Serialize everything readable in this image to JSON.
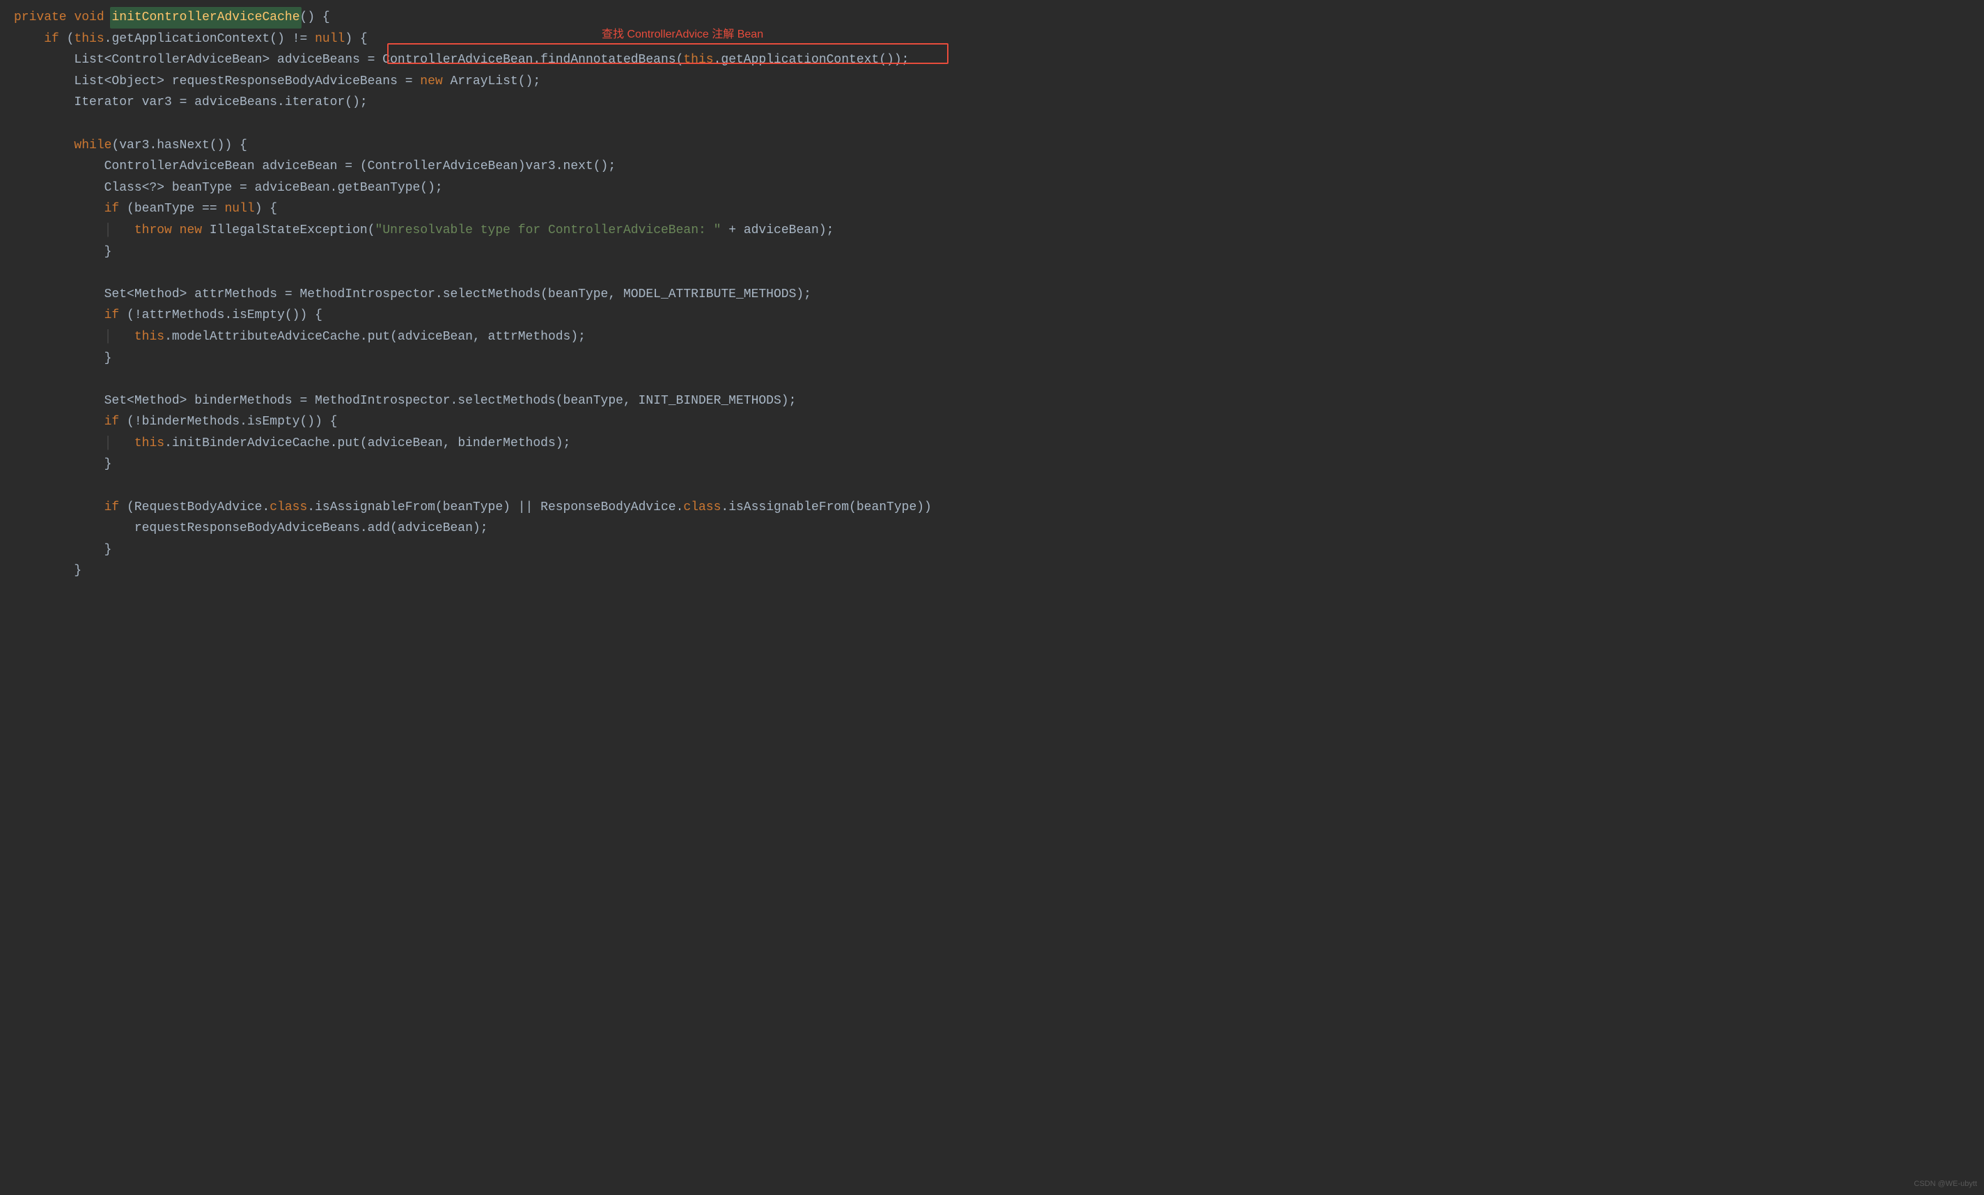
{
  "annotation": "查找 ControllerAdvice 注解 Bean",
  "watermark": "CSDN @WE-ubytt",
  "code": {
    "kw_private": "private",
    "kw_void": "void",
    "kw_if": "if",
    "kw_null": "null",
    "kw_new": "new",
    "kw_while": "while",
    "kw_throw": "throw",
    "kw_this": "this",
    "kw_class": "class",
    "method_def": "initControllerAdviceCache",
    "l1_tail": "() {",
    "l2_a": "    ",
    "l2_b": " (",
    "l2_c": ".getApplicationContext() != ",
    "l2_d": ") {",
    "l3_a": "        List<ControllerAdviceBean> adviceBeans = ",
    "l3_box": "ControllerAdviceBean.findAnnotatedBeans(",
    "l3_c": ".getApplicationContext());",
    "l4_a": "        List<Object> requestResponseBodyAdviceBeans = ",
    "l4_b": " ArrayList();",
    "l5": "        Iterator var3 = adviceBeans.iterator();",
    "l6_a": "        ",
    "l6_b": "(var3.hasNext()) {",
    "l7": "            ControllerAdviceBean adviceBean = (ControllerAdviceBean)var3.next();",
    "l8": "            Class<?> beanType = adviceBean.getBeanType();",
    "l9_a": "            ",
    "l9_b": " (beanType == ",
    "l9_c": ") {",
    "l10_a": "            ",
    "l10_b": "    ",
    "l10_c": " IllegalStateException(",
    "l10_str": "\"Unresolvable type for ControllerAdviceBean: \"",
    "l10_d": " + adviceBean);",
    "l11": "            }",
    "l12": "            Set<Method> attrMethods = MethodIntrospector.selectMethods(beanType, MODEL_ATTRIBUTE_METHODS);",
    "l13_a": "            ",
    "l13_b": " (!attrMethods.isEmpty()) {",
    "l14_a": "            ",
    "l14_b": "    ",
    "l14_c": ".modelAttributeAdviceCache.put(adviceBean, attrMethods);",
    "l15": "            }",
    "l16": "            Set<Method> binderMethods = MethodIntrospector.selectMethods(beanType, INIT_BINDER_METHODS);",
    "l17_a": "            ",
    "l17_b": " (!binderMethods.isEmpty()) {",
    "l18_a": "            ",
    "l18_b": "    ",
    "l18_c": ".initBinderAdviceCache.put(adviceBean, binderMethods);",
    "l19": "            }",
    "l20_a": "            ",
    "l20_b": " (RequestBodyAdvice.",
    "l20_c": ".isAssignableFrom(beanType) || ResponseBodyAdvice.",
    "l20_d": ".isAssignableFrom(beanType))",
    "l21": "                requestResponseBodyAdviceBeans.add(adviceBean);",
    "l22": "            }",
    "l23": "        }",
    "guide1": "│   ",
    "guide2": "│   │   "
  }
}
